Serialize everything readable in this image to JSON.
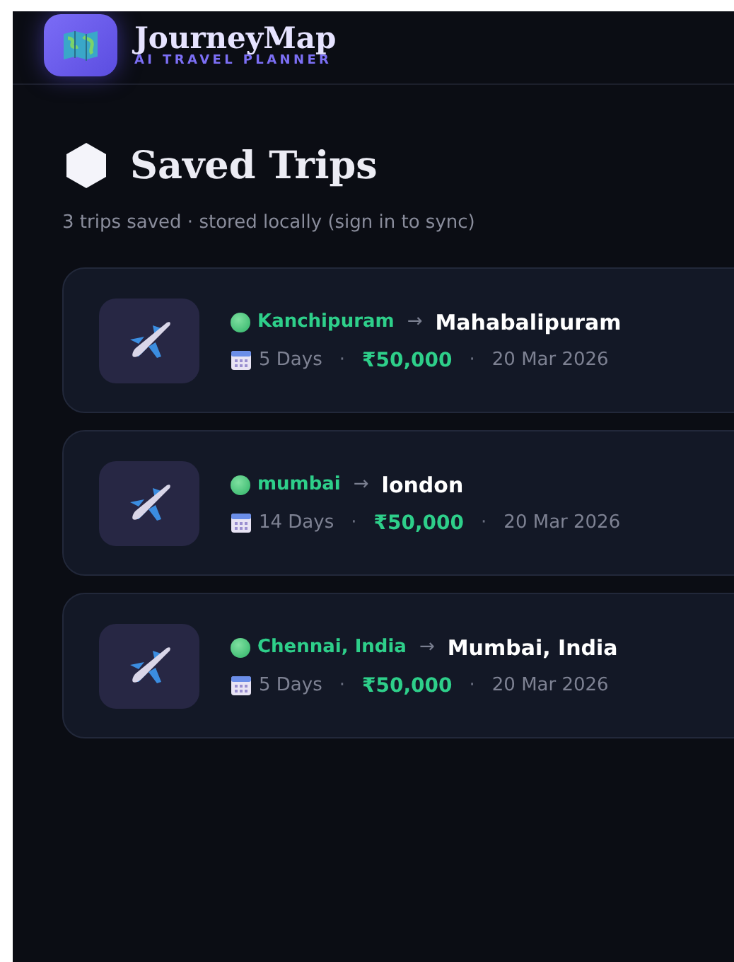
{
  "brand": {
    "name": "JourneyMap",
    "tagline": "AI TRAVEL PLANNER"
  },
  "page": {
    "title": "Saved Trips",
    "subtitle": "3 trips saved · stored locally (sign in to sync)"
  },
  "trips": [
    {
      "from": "Kanchipuram",
      "arrow": "→",
      "to": "Mahabalipuram",
      "days": "5 Days",
      "sep1": "·",
      "budget": "₹50,000",
      "sep2": "·",
      "date": "20 Mar 2026"
    },
    {
      "from": "mumbai",
      "arrow": "→",
      "to": "london",
      "days": "14 Days",
      "sep1": "·",
      "budget": "₹50,000",
      "sep2": "·",
      "date": "20 Mar 2026"
    },
    {
      "from": "Chennai, India",
      "arrow": "→",
      "to": "Mumbai, India",
      "days": "5 Days",
      "sep1": "·",
      "budget": "₹50,000",
      "sep2": "·",
      "date": "20 Mar 2026"
    }
  ]
}
